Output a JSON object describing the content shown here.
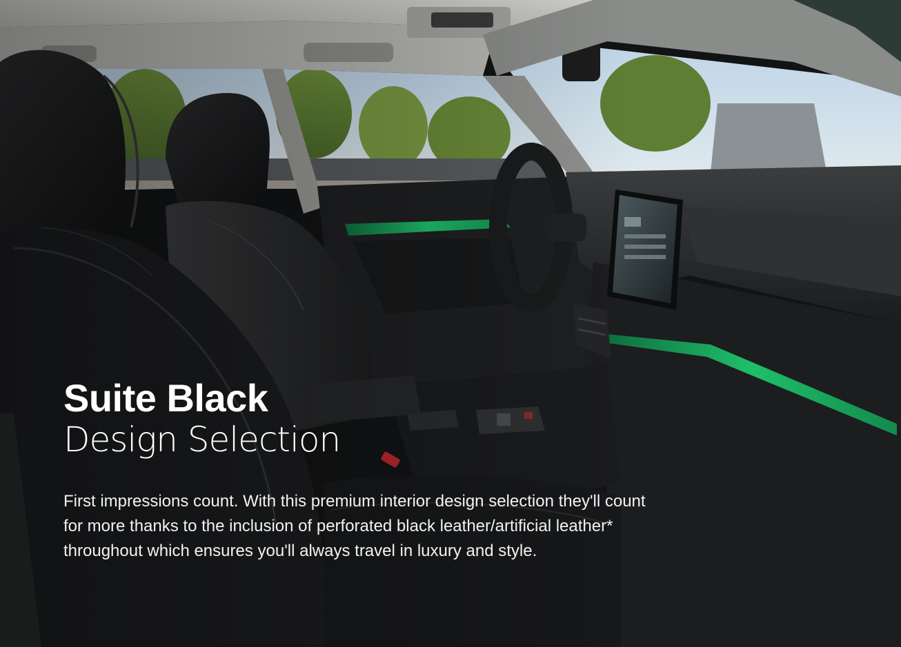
{
  "hero": {
    "title_bold": "Suite Black",
    "title_light": "Design Selection",
    "description": "First impressions count. With this premium interior design selection they'll count for more thanks to the inclusion of perforated black leather/artificial leather* throughout which ensures you'll always travel in luxury and style."
  },
  "colors": {
    "text": "#ffffff",
    "ambient_light_accent": "#1fbf6a",
    "leather": "#1a1b1d",
    "dashboard": "#2a2c2e"
  },
  "icons": [
    "car-interior-image"
  ]
}
